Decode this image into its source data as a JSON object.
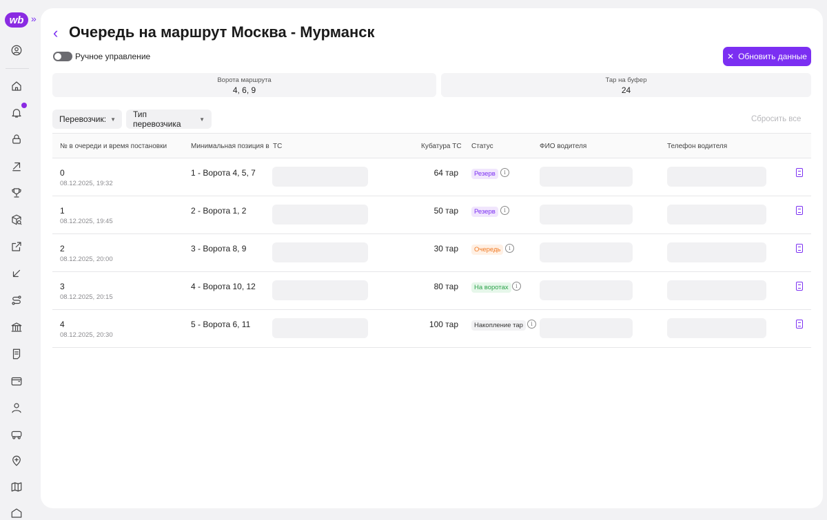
{
  "app": {
    "logo": "wb",
    "expand": "»"
  },
  "sidebar": {
    "icons": [
      "user-circle-icon",
      "home-icon",
      "bell-icon",
      "lock-icon",
      "arrow-up-right-icon",
      "trophy-icon",
      "box-search-icon",
      "external-link-icon",
      "arrow-down-left-icon",
      "route-icon",
      "bank-icon",
      "document-icon",
      "wallet-icon",
      "person-icon",
      "truck-icon",
      "location-plus-icon",
      "map-icon",
      "warehouse-icon"
    ]
  },
  "header": {
    "title": "Очередь на маршрут Москва - Мурманск",
    "toggle_label": "Ручное управление",
    "refresh_label": "Обновить данные"
  },
  "info": {
    "gates_label": "Ворота маршрута",
    "gates_value": "4, 6, 9",
    "buffer_label": "Тар на буфер",
    "buffer_value": "24"
  },
  "filters": {
    "carrier": "Перевозчик:",
    "carrier_type": "Тип перевозчика",
    "reset": "Сбросить все"
  },
  "table": {
    "headers": {
      "queue": "№ в очереди и время постановки",
      "min_pos": "Минимальная позиция в",
      "ts": "ТС",
      "cubature": "Кубатура ТС",
      "status": "Статус",
      "driver": "ФИО водителя",
      "phone": "Телефон водителя"
    },
    "rows": [
      {
        "num": "0",
        "time": "08.12.2025, 19:32",
        "pos": "1 - Ворота 4, 5, 7",
        "cube": "64 тар",
        "status": "Резерв",
        "status_kind": "rez"
      },
      {
        "num": "1",
        "time": "08.12.2025, 19:45",
        "pos": "2 - Ворота 1, 2",
        "cube": "50 тар",
        "status": "Резерв",
        "status_kind": "rez"
      },
      {
        "num": "2",
        "time": "08.12.2025, 20:00",
        "pos": "3 - Ворота 8, 9",
        "cube": "30 тар",
        "status": "Очередь",
        "status_kind": "och"
      },
      {
        "num": "3",
        "time": "08.12.2025, 20:15",
        "pos": "4 - Ворота 10, 12",
        "cube": "80 тар",
        "status": "На воротах",
        "status_kind": "vor"
      },
      {
        "num": "4",
        "time": "08.12.2025, 20:30",
        "pos": "5 - Ворота 6, 11",
        "cube": "100 тар",
        "status": "Накопление тар",
        "status_kind": "nak"
      }
    ]
  },
  "colors": {
    "accent": "#7b2ff2"
  }
}
